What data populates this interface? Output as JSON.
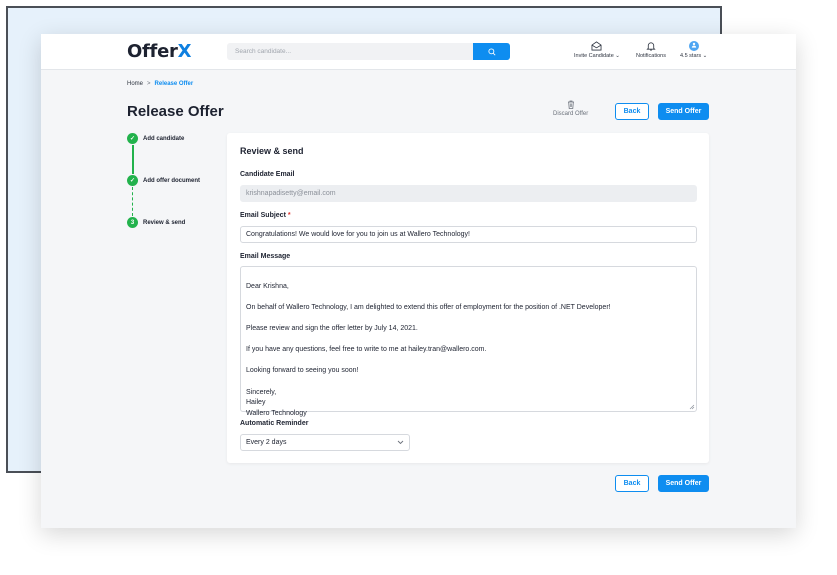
{
  "app": {
    "logo_text": "Offer",
    "logo_accent": "X"
  },
  "search": {
    "placeholder": "Search candidate..."
  },
  "nav": {
    "invite_label": "Invite Candidate",
    "notifications_label": "Notifications",
    "rating_label": "4.5 stars"
  },
  "breadcrumb": {
    "home": "Home",
    "separator": ">",
    "current": "Release Offer"
  },
  "page": {
    "title": "Release Offer"
  },
  "actions": {
    "discard_label": "Discard Offer",
    "back_label": "Back",
    "send_label": "Send Offer"
  },
  "steps": [
    {
      "label": "Add candidate",
      "state": "done"
    },
    {
      "label": "Add offer document",
      "state": "done"
    },
    {
      "number": "3",
      "label": "Review & send",
      "state": "current"
    }
  ],
  "form": {
    "title": "Review & send",
    "email_label": "Candidate Email",
    "email_value": "krishnapadisetty@email.com",
    "subject_label": "Email Subject",
    "subject_required": "*",
    "subject_value": "Congratulations! We would love for you to join us at Wallero Technology!",
    "message_label": "Email Message",
    "message_value": "Dear Krishna,\n\nOn behalf of Wallero Technology, I am delighted to extend this offer of employment for the position of .NET Developer!\n\nPlease review and sign the offer letter by July 14, 2021.\n\nIf you have any questions, feel free to write to me at hailey.tran@wallero.com.\n\nLooking forward to seeing you soon!\n\nSincerely,\nHailey\nWallero Technology",
    "reminder_label": "Automatic Reminder",
    "reminder_value": "Every 2 days"
  },
  "colors": {
    "accent": "#0e8df0",
    "success": "#22b24c",
    "required": "#e0342d"
  }
}
